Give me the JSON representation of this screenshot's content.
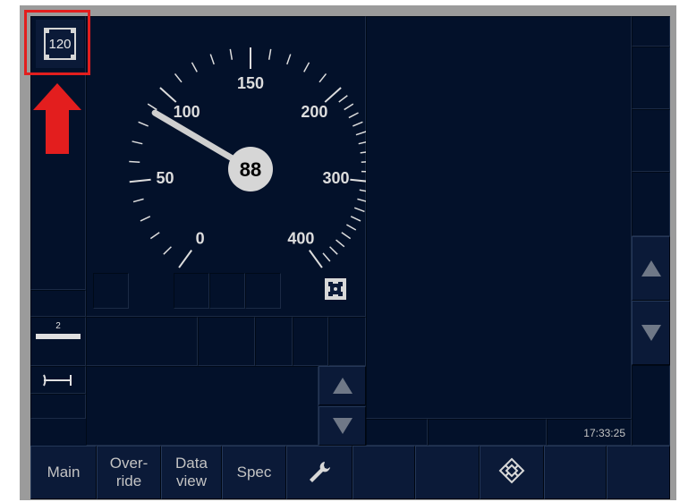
{
  "vmax_indicator": {
    "value": "120"
  },
  "speedometer": {
    "labels": [
      "0",
      "50",
      "100",
      "150",
      "200",
      "300",
      "400"
    ],
    "current_speed": "88",
    "needle_speed": 88
  },
  "brake_indicator": {
    "value": "2"
  },
  "clock": {
    "time": "17:33:25"
  },
  "bottom_menu": {
    "main": "Main",
    "override_line1": "Over-",
    "override_line2": "ride",
    "dataview_line1": "Data",
    "dataview_line2": "view",
    "spec": "Spec"
  },
  "colors": {
    "background": "#03112a",
    "highlight": "#e31e1e",
    "gauge_white": "#dddddd"
  },
  "icons": [
    "target-speed-icon",
    "wrench-icon",
    "train-data-icon",
    "scroll-up-icon",
    "scroll-down-icon",
    "distance-icon",
    "arrow-up-icon"
  ]
}
